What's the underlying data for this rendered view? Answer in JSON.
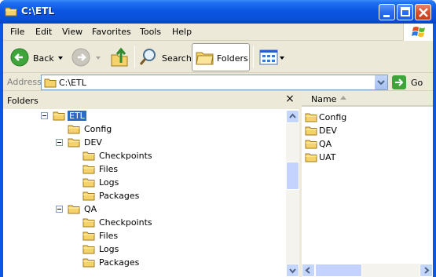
{
  "window": {
    "title": "C:\\ETL"
  },
  "menu": [
    {
      "key": "F",
      "rest": "ile"
    },
    {
      "key": "E",
      "rest": "dit"
    },
    {
      "key": "V",
      "rest": "iew"
    },
    {
      "key": "a",
      "rest": "",
      "prefix": "F",
      "suffix": "vorites"
    },
    {
      "key": "T",
      "rest": "ools"
    },
    {
      "key": "H",
      "rest": "elp"
    }
  ],
  "menu_labels": {
    "file": "File",
    "edit": "Edit",
    "view": "View",
    "favorites": "Favorites",
    "tools": "Tools",
    "help": "Help"
  },
  "toolbar": {
    "back_label": "Back",
    "search_label": "Search",
    "folders_label": "Folders"
  },
  "address": {
    "label": "Address",
    "value": "C:\\ETL",
    "go_label": "Go"
  },
  "folders_pane": {
    "title": "Folders",
    "close_glyph": "×",
    "tree": [
      {
        "label": "ETL",
        "expander": "minus",
        "selected": true
      },
      {
        "label": "Config"
      },
      {
        "label": "DEV",
        "expander": "minus"
      },
      {
        "label": "Checkpoints"
      },
      {
        "label": "Files"
      },
      {
        "label": "Logs"
      },
      {
        "label": "Packages"
      },
      {
        "label": "QA",
        "expander": "minus"
      },
      {
        "label": "Checkpoints"
      },
      {
        "label": "Files"
      },
      {
        "label": "Logs"
      },
      {
        "label": "Packages"
      }
    ]
  },
  "content_pane": {
    "column_name": "Name",
    "items": [
      "Config",
      "DEV",
      "QA",
      "UAT"
    ]
  },
  "colors": {
    "titlebar": "#0b56e3",
    "selection": "#316ac5",
    "folder_yellow": "#f5d36a"
  }
}
